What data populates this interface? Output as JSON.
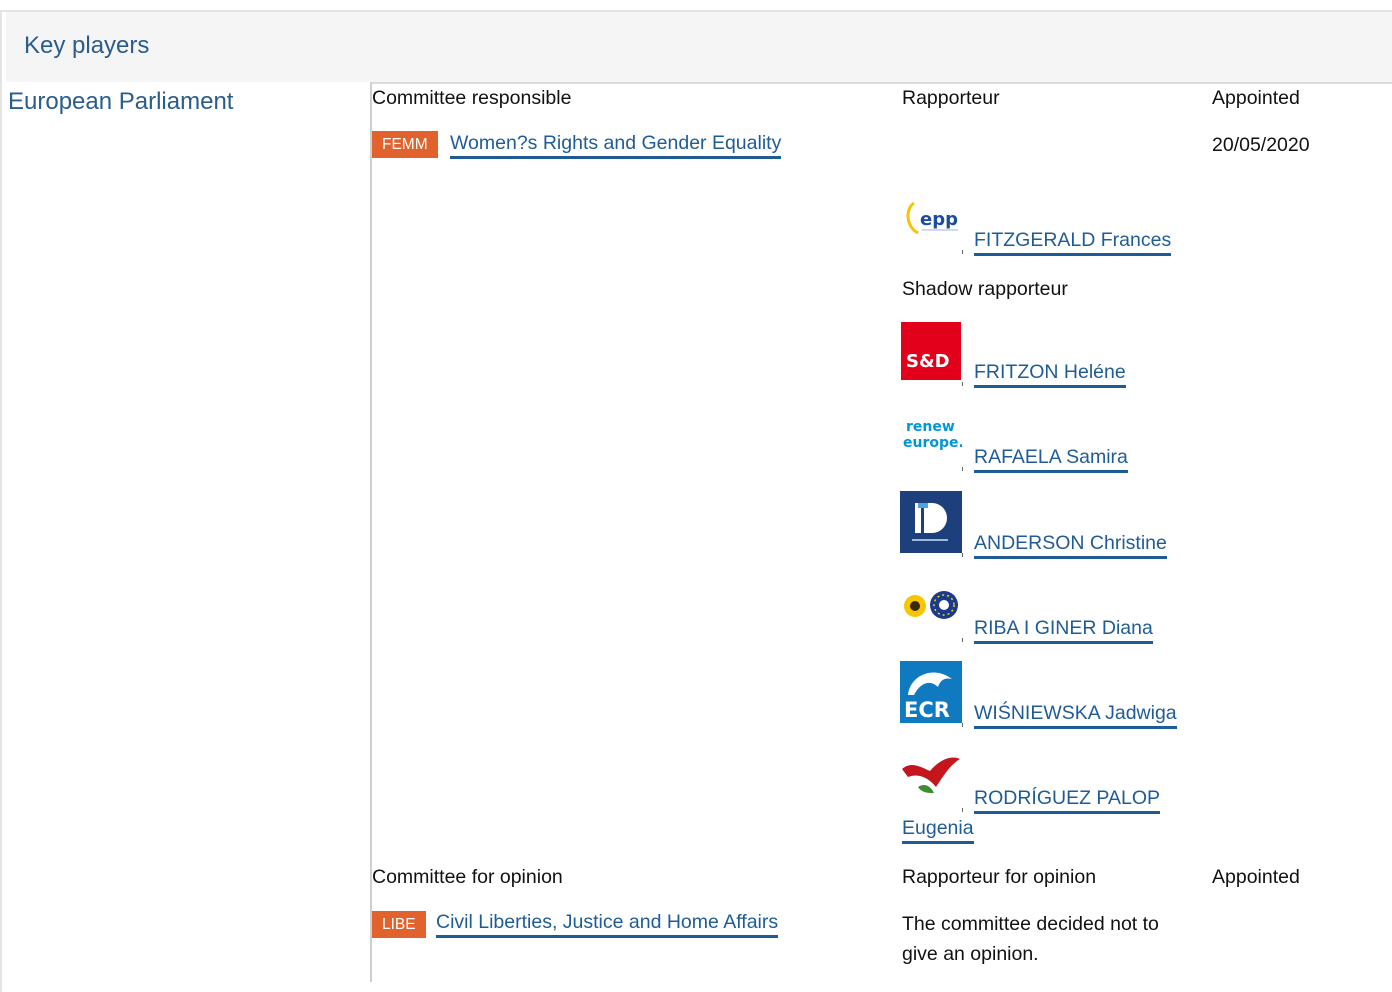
{
  "section": {
    "title": "Key players"
  },
  "institution": {
    "name": "European Parliament"
  },
  "responsible": {
    "col_committee": "Committee responsible",
    "col_rapporteur": "Rapporteur",
    "col_appointed": "Appointed",
    "committee_code": "FEMM",
    "committee_name": "Women?s Rights and Gender Equality",
    "appointed_date": "20/05/2020",
    "rapporteur": {
      "name": "FITZGERALD Frances",
      "group_icon": "epp-logo-icon",
      "group_text": "epp"
    },
    "shadow_label": "Shadow rapporteur",
    "shadows": [
      {
        "name": "FRITZON Heléne",
        "group_icon": "sd-logo-icon",
        "group_text": "S&D",
        "color": "#e3001b"
      },
      {
        "name": "RAFAELA Samira",
        "group_icon": "renew-europe-logo-icon",
        "group_text_1": "renew",
        "group_text_2": "europe.",
        "color": "#0097d7"
      },
      {
        "name": "ANDERSON Christine",
        "group_icon": "id-logo-icon",
        "group_text": "D",
        "color": "#1d3f7c"
      },
      {
        "name": "RIBA I GINER Diana",
        "group_icon": "greens-efa-logo-icon"
      },
      {
        "name": "WIŚNIEWSKA Jadwiga",
        "group_icon": "ecr-logo-icon",
        "group_text": "ECR",
        "color": "#0f7ac0"
      },
      {
        "name_line1": "RODRÍGUEZ PALOP",
        "name_line2": "Eugenia",
        "group_icon": "left-logo-icon"
      }
    ]
  },
  "opinion": {
    "col_committee": "Committee for opinion",
    "col_rapporteur": "Rapporteur for opinion",
    "col_appointed": "Appointed",
    "committee_code": "LIBE",
    "committee_name": "Civil Liberties, Justice and Home Affairs",
    "note_line1": "The committee decided not to",
    "note_line2": "give an opinion."
  },
  "colors": {
    "accent_link": "#1f5c96",
    "badge": "#e2622e",
    "header_text": "#2a5d8c"
  }
}
